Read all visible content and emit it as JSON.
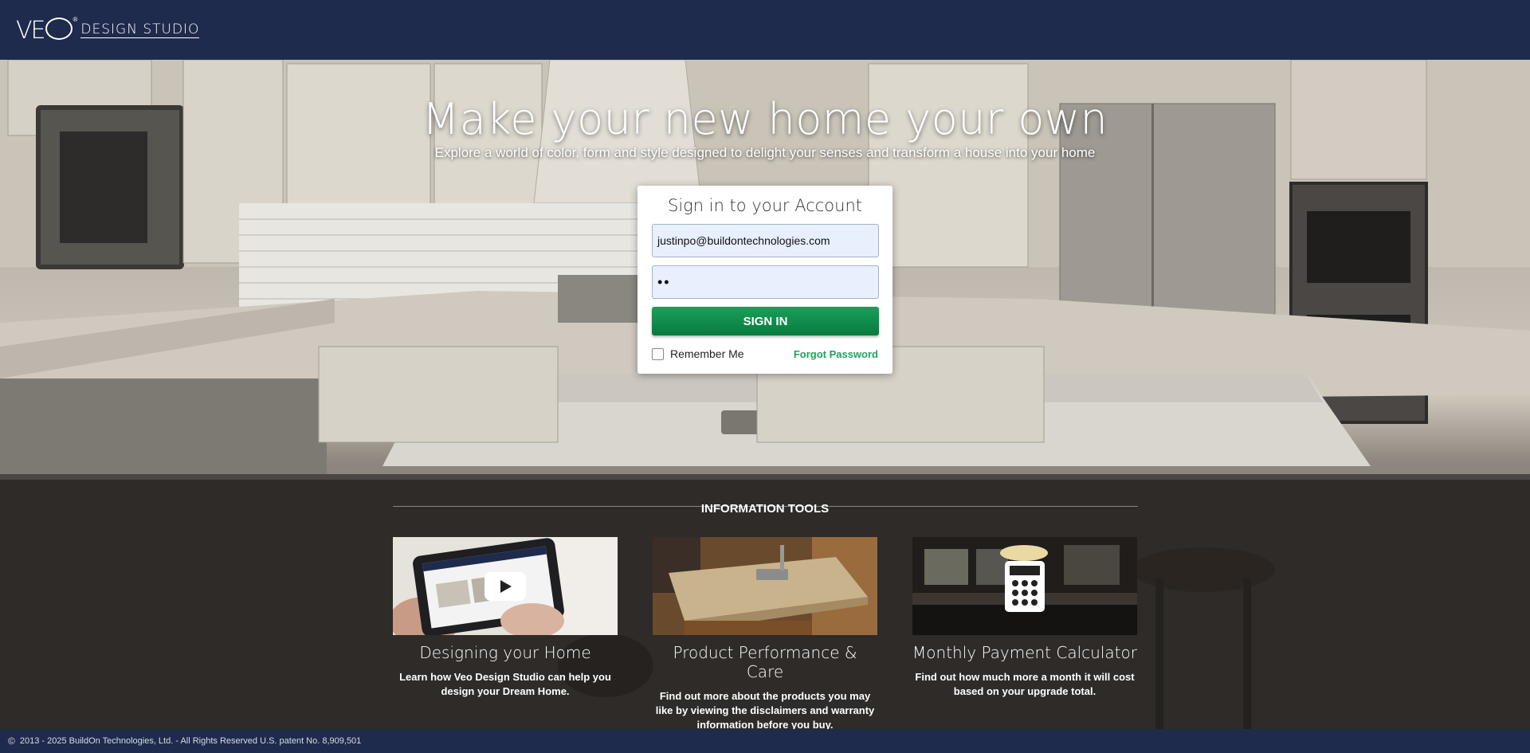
{
  "header": {
    "logo_mark": "VE",
    "logo_registered": "®",
    "logo_studio": "DESIGN STUDIO"
  },
  "hero": {
    "headline": "Make your new home your own",
    "subhead": "Explore a world of color, form and style designed to delight your senses and transform a house into your home"
  },
  "signin": {
    "title": "Sign in to your Account",
    "email_value": "justinpo@buildontechnologies.com",
    "password_value": "••",
    "button_label": "SIGN IN",
    "remember_label": "Remember Me",
    "forgot_label": "Forgot Password"
  },
  "tools": {
    "title": "INFORMATION TOOLS",
    "items": [
      {
        "name": "Designing your Home",
        "desc": "Learn how Veo Design Studio can help you design your Dream Home."
      },
      {
        "name": "Product Performance & Care",
        "desc": "Find out more about the products you may like by viewing the disclaimers and warranty information before you buy."
      },
      {
        "name": "Monthly Payment Calculator",
        "desc": "Find out how much more a month it will cost based on your upgrade total."
      }
    ]
  },
  "footer": {
    "copyright_symbol": "©",
    "text": "2013 - 2025 BuildOn Technologies, Ltd. - All Rights Reserved U.S. patent No. 8,909,501"
  },
  "colors": {
    "header_bg": "#1f2b4d",
    "signin_green": "#0b7a3e",
    "link_green": "#1aa360"
  }
}
